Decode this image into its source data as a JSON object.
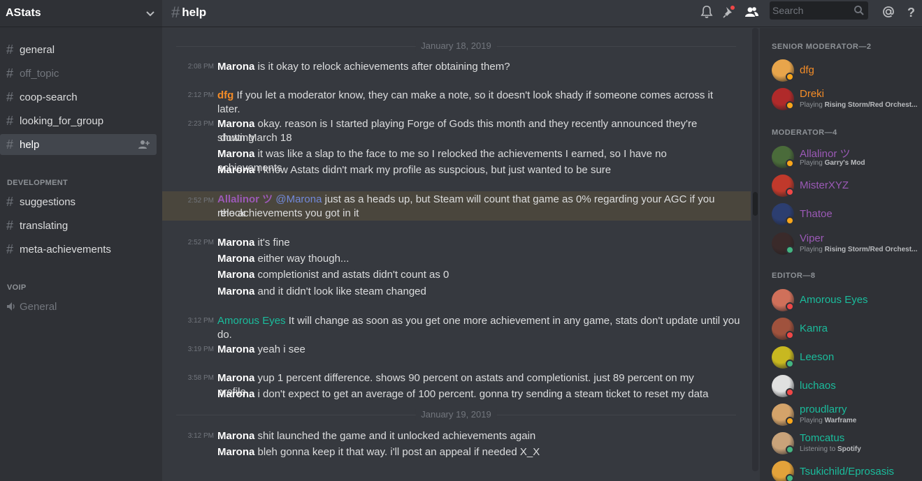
{
  "server": {
    "name": "AStats"
  },
  "channels": [
    {
      "name": "general",
      "muted": false
    },
    {
      "name": "off_topic",
      "muted": true
    },
    {
      "name": "coop-search",
      "muted": false
    },
    {
      "name": "looking_for_group",
      "muted": false
    },
    {
      "name": "help",
      "muted": false,
      "active": true
    }
  ],
  "categories": {
    "development": "DEVELOPMENT",
    "voip": "VOIP"
  },
  "dev_channels": [
    {
      "name": "suggestions"
    },
    {
      "name": "translating"
    },
    {
      "name": "meta-achievements"
    }
  ],
  "voice_channels": [
    {
      "name": "General"
    }
  ],
  "header": {
    "channel": "help",
    "hash": "#",
    "search_placeholder": "Search"
  },
  "dividers": [
    "January 18, 2019",
    "January 19, 2019"
  ],
  "messages": [
    {
      "time": "2:08 PM",
      "author": "Marona",
      "author_color": "#ffffff",
      "lines": [
        "is it okay to relock achievements after obtaining them?"
      ]
    },
    {
      "time": "2:12 PM",
      "author": "dfg",
      "author_color": "#f48c27",
      "lines": [
        "If you let a moderator know, they can make a note, so it doesn't look shady if someone comes across it later."
      ]
    },
    {
      "time": "2:23 PM",
      "author": "Marona",
      "author_color": "#ffffff",
      "lines": [
        "okay. reason is I started playing Forge of Gods this month and they recently announced they're shutting",
        "down March 18"
      ]
    },
    {
      "time": "",
      "author": "Marona",
      "author_color": "#ffffff",
      "lines": [
        "it was like a slap to the face to me so I relocked the achievements I earned, so I have no achievements"
      ]
    },
    {
      "time": "",
      "author": "Marona",
      "author_color": "#ffffff",
      "lines": [
        "I know Astats didn't mark my profile as suspcious, but just wanted to be sure"
      ]
    },
    {
      "time": "2:52 PM",
      "author": "Allalinor ツ",
      "author_color": "#9b59b6",
      "mention": "@Marona",
      "lines": [
        "just as a heads up, but Steam will count that game as 0% regarding your AGC if you relock",
        "the achievements you got in it"
      ]
    },
    {
      "time": "2:52 PM",
      "author": "Marona",
      "author_color": "#ffffff",
      "lines": [
        "it's fine"
      ]
    },
    {
      "time": "",
      "author": "Marona",
      "author_color": "#ffffff",
      "lines": [
        "either way though..."
      ]
    },
    {
      "time": "",
      "author": "Marona",
      "author_color": "#ffffff",
      "lines": [
        "completionist and astats didn't count as 0"
      ]
    },
    {
      "time": "",
      "author": "Marona",
      "author_color": "#ffffff",
      "lines": [
        "and it didn't look like steam changed"
      ]
    },
    {
      "time": "3:12 PM",
      "author": "Amorous Eyes",
      "author_color": "#1abc9c",
      "lines": [
        "It will change as soon as you get one more achievement in any game, stats don't update until you do."
      ]
    },
    {
      "time": "3:19 PM",
      "author": "Marona",
      "author_color": "#ffffff",
      "lines": [
        "yeah i see"
      ]
    },
    {
      "time": "3:58 PM",
      "author": "Marona",
      "author_color": "#ffffff",
      "lines": [
        "yup 1 percent difference. shows 90 percent on astats and completionist. just 89 percent on my profile."
      ]
    },
    {
      "time": "",
      "author": "Marona",
      "author_color": "#ffffff",
      "lines": [
        "i don't expect to get an average of 100 percent. gonna try sending a steam ticket to reset my data"
      ]
    },
    {
      "time": "3:12 PM",
      "author": "Marona",
      "author_color": "#ffffff",
      "lines": [
        "shit launched the game and it unlocked achievements again"
      ]
    },
    {
      "time": "",
      "author": "Marona",
      "author_color": "#ffffff",
      "lines": [
        "bleh gonna keep it that way. i'll post an appeal if needed X_X"
      ]
    }
  ],
  "member_groups": [
    {
      "title": "SENIOR MODERATOR—2"
    },
    {
      "title": "MODERATOR—4"
    },
    {
      "title": "EDITOR—8"
    }
  ],
  "members": [
    {
      "name": "dfg",
      "color": "#f48c27",
      "status_color": "#faa61a",
      "avatar_color": "#e8a54b"
    },
    {
      "name": "Dreki",
      "color": "#f48c27",
      "status_color": "#faa61a",
      "avatar_color": "#b02a2a",
      "activity_prefix": "Playing",
      "activity": "Rising Storm/Red Orchest..."
    },
    {
      "name": "Allalinor ツ",
      "color": "#9b59b6",
      "status_color": "#faa61a",
      "avatar_color": "#4a6b3a",
      "activity_prefix": "Playing",
      "activity": "Garry's Mod"
    },
    {
      "name": "MisterXYZ",
      "color": "#9b59b6",
      "status_color": "#f04747",
      "avatar_color": "#c0392b"
    },
    {
      "name": "Thatoe",
      "color": "#9b59b6",
      "status_color": "#faa61a",
      "avatar_color": "#2c3e70"
    },
    {
      "name": "Viper",
      "color": "#9b59b6",
      "status_color": "#43b581",
      "avatar_color": "#3a2a2a",
      "activity_prefix": "Playing",
      "activity": "Rising Storm/Red Orchest..."
    },
    {
      "name": "Amorous Eyes",
      "color": "#1abc9c",
      "status_color": "#f04747",
      "avatar_color": "#d0705a"
    },
    {
      "name": "Kanra",
      "color": "#1abc9c",
      "status_color": "#f04747",
      "avatar_color": "#a0523d"
    },
    {
      "name": "Leeson",
      "color": "#1abc9c",
      "status_color": "#43b581",
      "avatar_color": "#c8b820"
    },
    {
      "name": "luchaos",
      "color": "#1abc9c",
      "status_color": "#f04747",
      "avatar_color": "#e0e0e0"
    },
    {
      "name": "proudlarry",
      "color": "#1abc9c",
      "status_color": "#faa61a",
      "avatar_color": "#d4a36a",
      "activity_prefix": "Playing",
      "activity": "Warframe"
    },
    {
      "name": "Tomcatus",
      "color": "#1abc9c",
      "status_color": "#43b581",
      "avatar_color": "#c9a37a",
      "activity_prefix": "Listening to",
      "activity": "Spotify"
    },
    {
      "name": "Tsukichild/Eprosasis",
      "color": "#1abc9c",
      "status_color": "#43b581",
      "avatar_color": "#e3a23a"
    }
  ]
}
